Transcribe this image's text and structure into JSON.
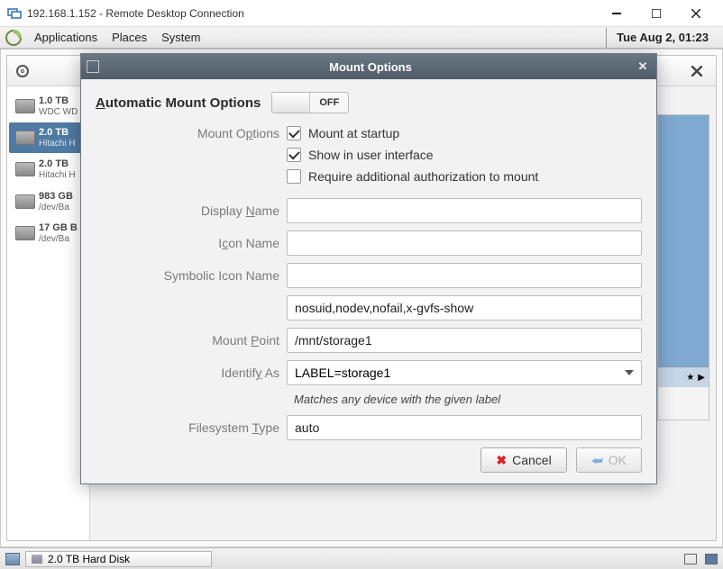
{
  "rdp": {
    "title": "192.168.1.152 - Remote Desktop Connection"
  },
  "panel": {
    "menus": [
      "Applications",
      "Places",
      "System"
    ],
    "clock": "Tue Aug  2, 01:23"
  },
  "disks": {
    "devices": [
      {
        "size": "1.0 TB",
        "model": "WDC WD"
      },
      {
        "size": "2.0 TB",
        "model": "Hitachi H"
      },
      {
        "size": "2.0 TB",
        "model": "Hitachi H"
      },
      {
        "size": "983 GB",
        "model": "/dev/Ba"
      },
      {
        "size": "17 GB B",
        "model": "/dev/Ba"
      }
    ]
  },
  "dialog": {
    "title": "Mount Options",
    "auto_heading": "Automatic Mount Options",
    "auto_state": "OFF",
    "labels": {
      "mount_options": "Mount Options",
      "display_name": "Display Name",
      "icon_name": "Icon Name",
      "symbolic_icon_name": "Symbolic Icon Name",
      "mount_point": "Mount Point",
      "identify_as": "Identify As",
      "filesystem_type": "Filesystem Type"
    },
    "checks": {
      "mount_at_startup": "Mount at startup",
      "show_in_ui": "Show in user interface",
      "require_auth": "Require additional authorization to mount"
    },
    "fields": {
      "display_name": "",
      "icon_name": "",
      "symbolic_icon_name": "",
      "flags": "nosuid,nodev,nofail,x-gvfs-show",
      "mount_point": "/mnt/storage1",
      "identify_as": "LABEL=storage1",
      "filesystem_type": "auto"
    },
    "identify_hint": "Matches any device with the given label",
    "buttons": {
      "cancel": "Cancel",
      "ok": "OK"
    }
  },
  "taskbar": {
    "task": "2.0 TB Hard Disk"
  }
}
